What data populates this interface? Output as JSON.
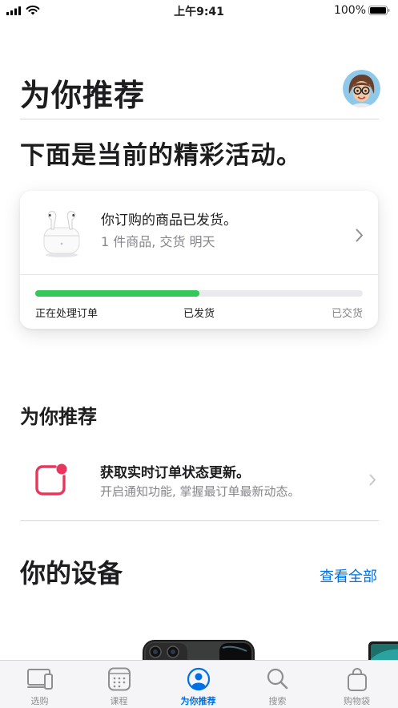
{
  "status_bar": {
    "time": "上午9:41",
    "battery": "100%"
  },
  "header": {
    "title": "为你推荐",
    "avatar_icon": "memoji-avatar-icon"
  },
  "headline": "下面是当前的精彩活动。",
  "order": {
    "title": "你订购的商品已发货。",
    "subtitle": "1 件商品, 交货 明天",
    "product_icon": "airpods-icon",
    "progress": 0.5,
    "steps": [
      "正在处理订单",
      "已发货",
      "已交货"
    ],
    "progress_color": "#34c759"
  },
  "recommend": {
    "section_title": "为你推荐",
    "notification_title": "获取实时订单状态更新。",
    "notification_subtitle": "开启通知功能, 掌握最订单最新动态。",
    "notification_icon": "notification-badge-icon",
    "accent": "#e8365d"
  },
  "devices": {
    "title": "你的设备",
    "see_all": "查看全部"
  },
  "tab_bar": {
    "active_color": "#0071e3",
    "tabs": [
      {
        "label": "选购",
        "icon": "devices-icon"
      },
      {
        "label": "课程",
        "icon": "calendar-icon"
      },
      {
        "label": "为你推荐",
        "icon": "person-circle-icon"
      },
      {
        "label": "搜索",
        "icon": "search-icon"
      },
      {
        "label": "购物袋",
        "icon": "bag-icon"
      }
    ]
  }
}
